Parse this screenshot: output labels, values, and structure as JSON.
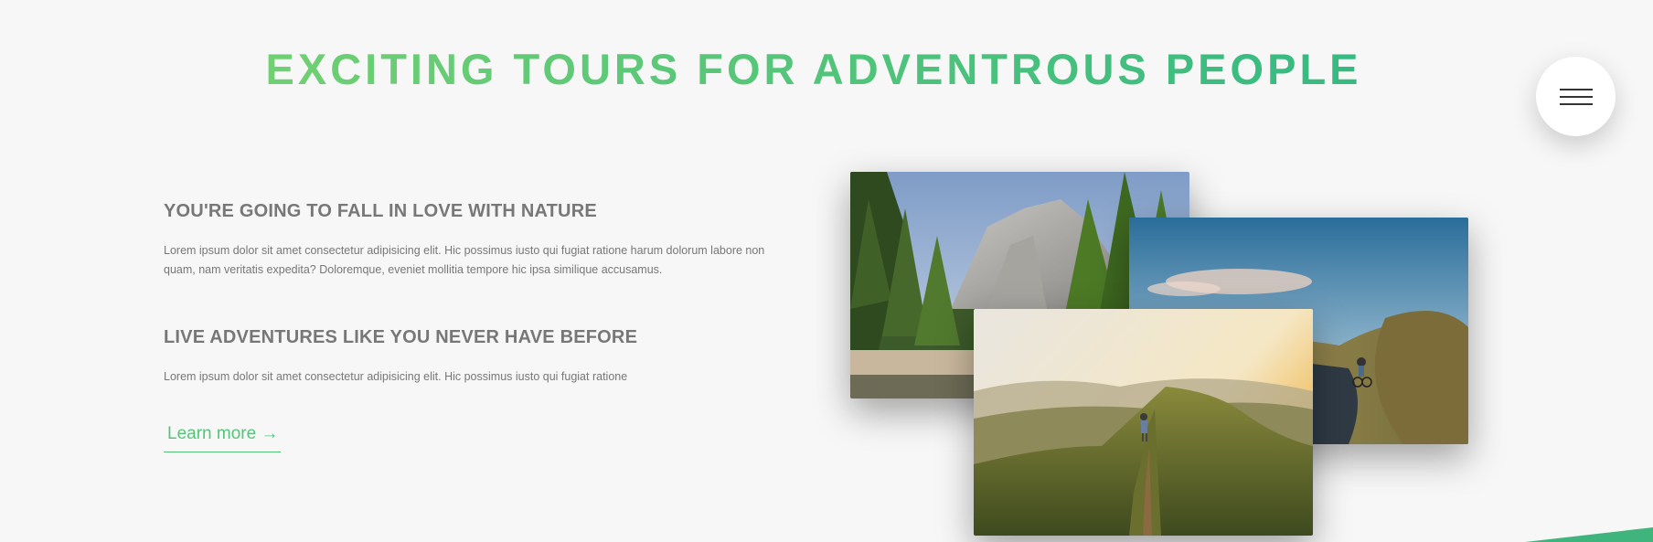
{
  "section": {
    "title": "EXCITING TOURS FOR ADVENTROUS PEOPLE"
  },
  "features": [
    {
      "heading": "YOU'RE GOING TO FALL IN LOVE WITH NATURE",
      "text": "Lorem ipsum dolor sit amet consectetur adipisicing elit. Hic possimus iusto qui fugiat ratione harum dolorum labore non quam, nam veritatis expedita? Doloremque, eveniet mollitia tempore hic ipsa similique accusamus."
    },
    {
      "heading": "LIVE ADVENTURES LIKE YOU NEVER HAVE BEFORE",
      "text": "Lorem ipsum dolor sit amet consectetur adipisicing elit. Hic possimus iusto qui fugiat ratione"
    }
  ],
  "cta": {
    "label": "Learn more →"
  },
  "navigation": {
    "icon": "hamburger-menu-icon"
  },
  "photos": [
    {
      "subject": "yosemite-valley-forest-cliffs"
    },
    {
      "subject": "cyclist-on-mountain-road"
    },
    {
      "subject": "hiker-on-mountain-ridge-sunset"
    }
  ],
  "colors": {
    "primary_light": "#7ed56f",
    "primary_dark": "#28b485",
    "primary": "#55c57a",
    "text": "#777777",
    "background": "#f7f7f7"
  }
}
